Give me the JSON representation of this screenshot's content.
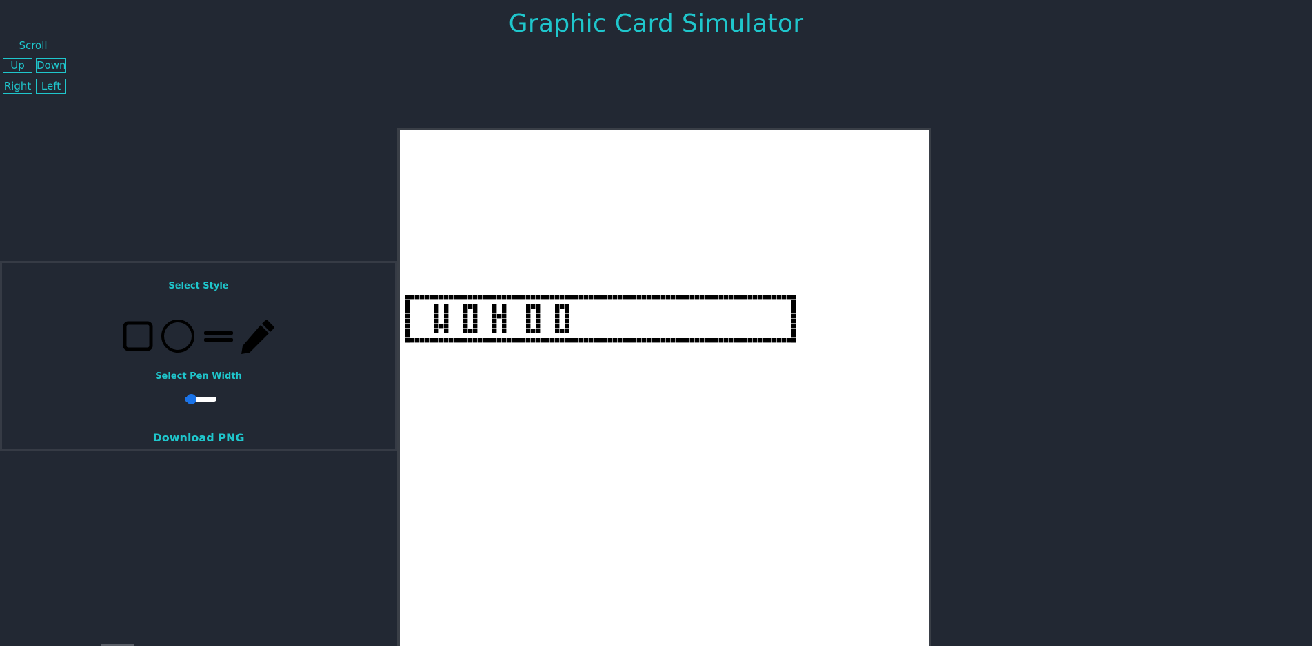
{
  "header": {
    "title": "Graphic Card Simulator"
  },
  "scroll": {
    "label": "Scroll",
    "up": "Up",
    "down": "Down",
    "right": "Right",
    "left": "Left"
  },
  "tools": {
    "style_label": "Select Style",
    "styles": [
      "square-icon",
      "circle-icon",
      "line-icon",
      "pencil-icon"
    ],
    "pen_width_label": "Select Pen Width",
    "pen_width_level": 0.2,
    "download_label": "Download PNG"
  },
  "canvas": {
    "text": "WOHOO",
    "background": "#ffffff",
    "ink": "#000000"
  },
  "colors": {
    "accent": "#1fc6cc",
    "background": "#222833",
    "slider": "#1a73e8"
  }
}
